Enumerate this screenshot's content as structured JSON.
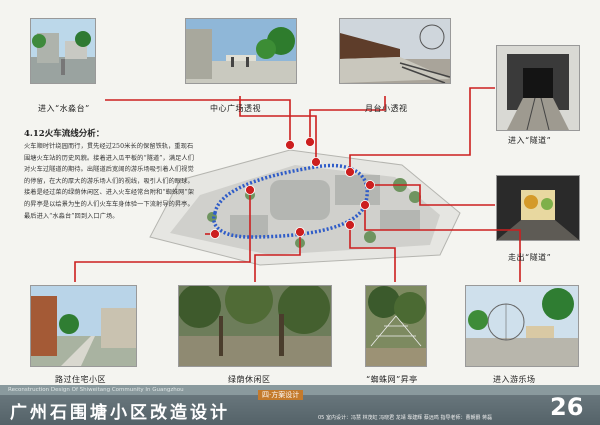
{
  "captions": {
    "shuimiaotai": "进入“水淼台”",
    "central_plaza": "中心广场透视",
    "platform": "月台小透视",
    "enter_tunnel": "进入“隧道”",
    "exit_tunnel": "走出“隧道”",
    "residential": "路过住宅小区",
    "greenery": "绿荫休闲区",
    "spider_gallery": "“蜘蛛网”昇亭",
    "playground": "进入游乐场"
  },
  "analysis": {
    "title": "4.12火车流线分析：",
    "body": "火车顺时针绕园而行，贯先经过250米长的保留铁轨，重现石围塘火车站的历史风貌。接着进入瓜平板的“隧道”，满足人们对火车过隧道的期待。出隧道后宽阔的游乐场吸引着人们视觉的停留，在大的厚大的游乐场人们的视线，吸引人们的眼球。接着是经过菜的绿荫休闲区、进入火车经常台附和“蜘蛛网”架的昇亭是以绘景为生的人们火车车身体验一下流射导的昇亭。最后进入“水淼台”回到入口广场。"
  },
  "footer": {
    "title": "广州石围塘小区改造设计",
    "english": "Reconstruction Design Of Shiweitang Community In Guangzhou",
    "section": "四·方案设计",
    "credits": "05 室内设计：冯慧 林茂虹 冯晓君 龙靖 靠建辉 蔡远鸣    指导老师：曹朝爵 蒋磊",
    "page": "26"
  },
  "colors": {
    "accent_red": "#cc1f1f",
    "route_blue": "#2f5cc8",
    "footer_bg": "#5d6b71"
  }
}
